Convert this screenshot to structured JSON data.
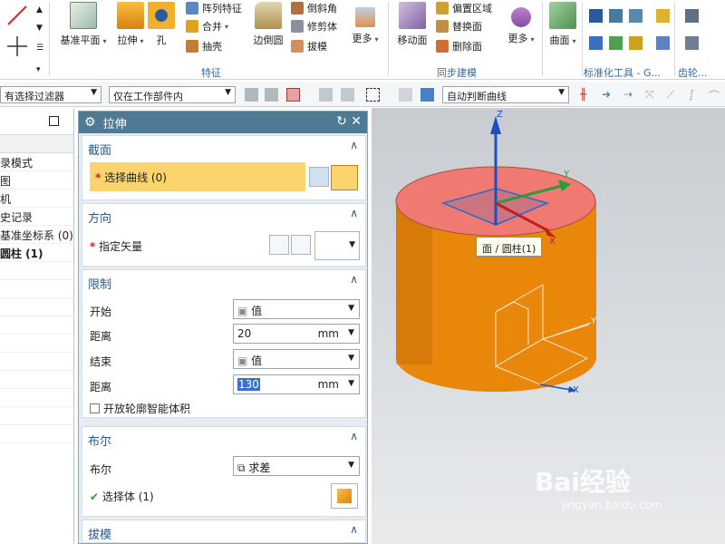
{
  "ribbon": {
    "feature_group": {
      "label": "特征",
      "datum_plane": "基准平面",
      "extrude": "拉伸",
      "hole": "孔",
      "pattern_feature": "阵列特征",
      "unite": "合并",
      "shell": "抽壳",
      "edge_blend": "边倒圆",
      "chamfer": "倒斜角",
      "trim_body": "修剪体",
      "draft": "拔模",
      "more": "更多"
    },
    "sync_group": {
      "label": "同步建模",
      "move_face": "移动面",
      "offset_region": "偏置区域",
      "replace_face": "替换面",
      "delete_face": "删除面",
      "more": "更多"
    },
    "surface_group": {
      "surface": "曲面"
    },
    "standard_tools_label": "标准化工具 - G...",
    "gear_label": "齿轮..."
  },
  "toolbar2": {
    "selection_filter": "有选择过滤器",
    "scope": "仅在工作部件内",
    "curve_rule": "自动判断曲线"
  },
  "navigator": {
    "rows": [
      "录模式",
      "图",
      "机",
      "史记录",
      "基准坐标系 (0)",
      "圆柱 (1)"
    ]
  },
  "dialog": {
    "title": "拉伸",
    "section": {
      "header": "截面",
      "select_curve": "选择曲线 (0)"
    },
    "direction": {
      "header": "方向",
      "specify_vector": "指定矢量"
    },
    "limits": {
      "header": "限制",
      "start_label": "开始",
      "start_option": "值",
      "start_distance_label": "距离",
      "start_distance": "20",
      "end_label": "结束",
      "end_option": "值",
      "end_distance_label": "距离",
      "end_distance": "130",
      "unit": "mm",
      "open_profile": "开放轮廓智能体积"
    },
    "boolean": {
      "header": "布尔",
      "label": "布尔",
      "option": "求差",
      "select_body": "选择体 (1)"
    },
    "draft": {
      "header": "拔模"
    }
  },
  "viewport": {
    "tooltip": "面 / 圆柱(1)",
    "axis_z": "Z",
    "axis_y": "Y",
    "axis_x": "X"
  },
  "watermark": {
    "main": "Bai经验",
    "sub": "jingyan.baidu.com"
  },
  "colors": {
    "cylinder_side": "#e8870a",
    "cylinder_top": "#f07a72",
    "dialog_title": "#4f7a96",
    "selection_highlight": "#fbd46e"
  }
}
